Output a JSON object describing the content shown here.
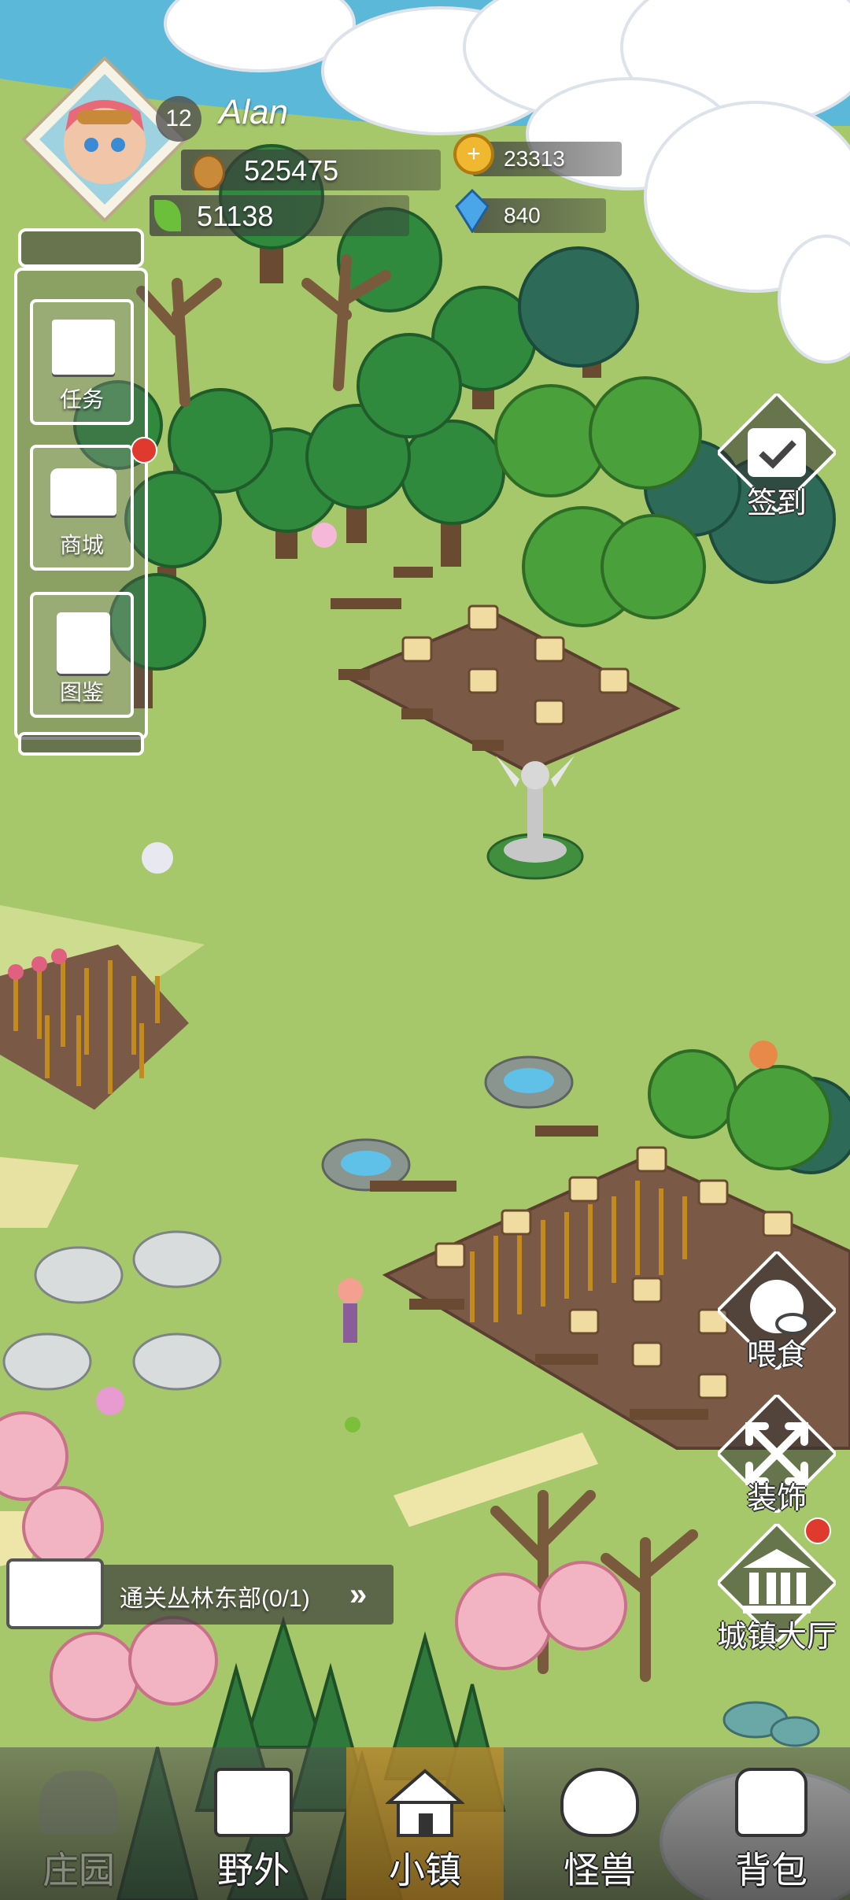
{
  "player": {
    "level": "12",
    "name": "Alan"
  },
  "resources": {
    "exp": "525475",
    "leaf": "51138",
    "gold": "23313",
    "diamond": "840"
  },
  "side_menu": [
    {
      "label": "任务",
      "icon": "book-icon"
    },
    {
      "label": "商城",
      "icon": "shop-icon"
    },
    {
      "label": "图鉴",
      "icon": "catalog-icon"
    }
  ],
  "right_buttons": {
    "checkin": "签到",
    "feed": "喂食",
    "decorate": "装饰",
    "town_hall": "城镇大厅"
  },
  "quest": {
    "text": "通关丛林东部(0/1)"
  },
  "bottom_nav": [
    {
      "label": "庄园"
    },
    {
      "label": "野外"
    },
    {
      "label": "小镇"
    },
    {
      "label": "怪兽"
    },
    {
      "label": "背包"
    }
  ],
  "colors": {
    "grass": "#a7c86a",
    "sea": "#5bb8d8",
    "soil": "#7a5a47",
    "wheat": "#e3b53c",
    "accent_red": "#e03a2f"
  }
}
